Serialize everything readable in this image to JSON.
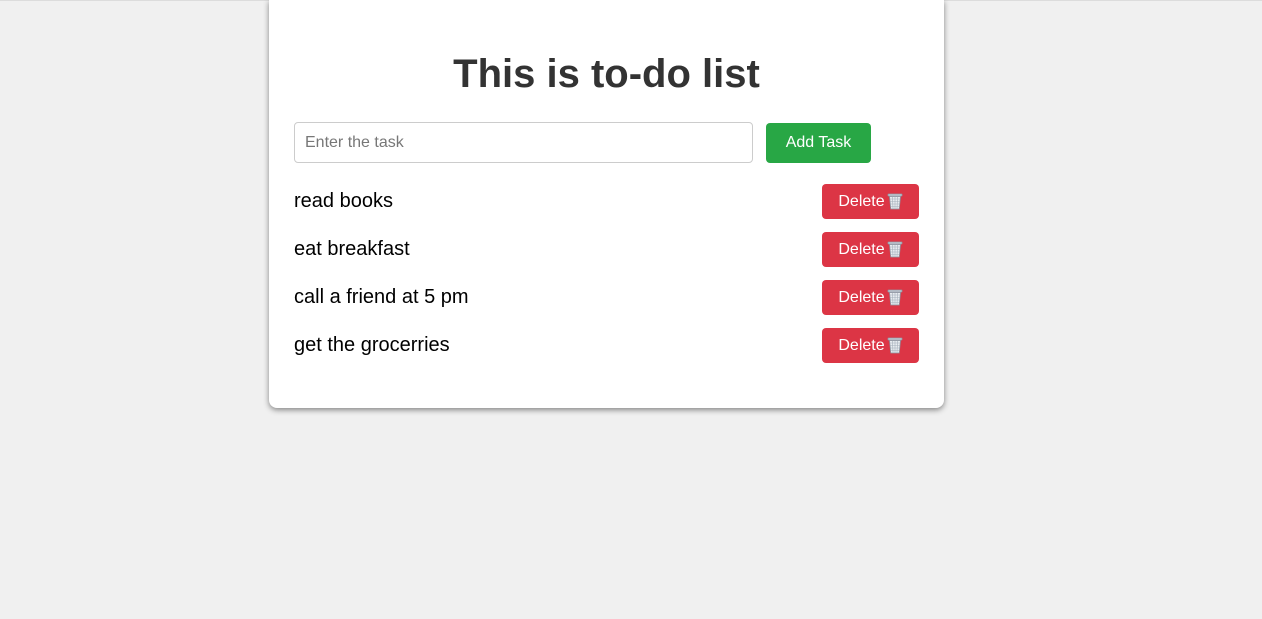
{
  "page": {
    "title": "This is to-do list"
  },
  "form": {
    "input_placeholder": "Enter the task",
    "input_value": "",
    "add_button_label": "Add Task"
  },
  "tasks": [
    {
      "text": "read books",
      "delete_label": "Delete",
      "delete_icon": "trash-can-icon"
    },
    {
      "text": "eat breakfast",
      "delete_label": "Delete",
      "delete_icon": "trash-can-icon"
    },
    {
      "text": "call a friend at 5 pm",
      "delete_label": "Delete",
      "delete_icon": "trash-can-icon"
    },
    {
      "text": "get the grocerries",
      "delete_label": "Delete",
      "delete_icon": "trash-can-icon"
    }
  ],
  "colors": {
    "background": "#f0f0f0",
    "card": "#ffffff",
    "title": "#333333",
    "add_button": "#28a745",
    "delete_button": "#dc3545",
    "button_text": "#ffffff"
  }
}
